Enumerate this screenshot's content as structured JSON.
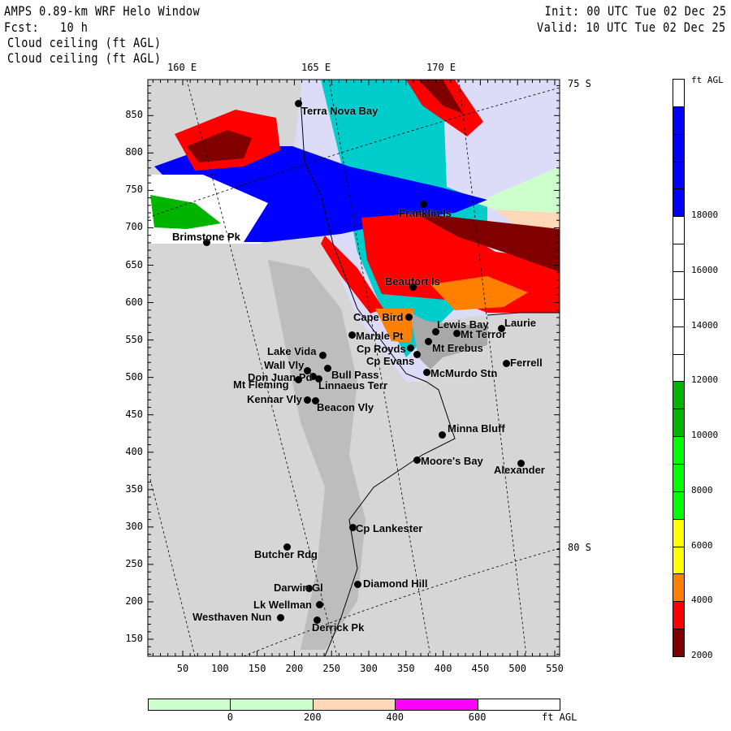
{
  "header": {
    "title": "AMPS 0.89-km WRF Helo Window",
    "forecast": "Fcst:   10 h",
    "field_line1": "Cloud ceiling (ft AGL)",
    "field_line2": "Cloud ceiling (ft AGL)",
    "init": "Init: 00 UTC Tue 02 Dec 25",
    "valid": "Valid: 10 UTC Tue 02 Dec 25"
  },
  "map": {
    "lon_labels": [
      "160 E",
      "165 E",
      "170 E"
    ],
    "lat_labels": [
      "75 S",
      "80 S"
    ],
    "y_ticks": [
      "850",
      "800",
      "750",
      "700",
      "650",
      "600",
      "550",
      "500",
      "450",
      "400",
      "350",
      "300",
      "250",
      "200",
      "150"
    ],
    "x_ticks": [
      "50",
      "100",
      "150",
      "200",
      "250",
      "300",
      "350",
      "400",
      "450",
      "500",
      "550"
    ],
    "stations": [
      "Terra Nova Bay",
      "Franklin Is",
      "Brimstone Pk",
      "Beaufort Is",
      "Cape Bird",
      "Lewis Bay",
      "Laurie",
      "Marble Pt",
      "Mt Terror",
      "Cp Royds",
      "Mt Erebus",
      "Lake Vida",
      "Cp Evans",
      "Ferrell",
      "Wall Vly",
      "Bull Pass",
      "McMurdo Stn",
      "Don Juan Pd",
      "Mt Fleming",
      "Linnaeus Terr",
      "Kennar Vly",
      "Beacon Vly",
      "Minna Bluff",
      "Moore's Bay",
      "Alexander",
      "Cp Lankester",
      "Butcher Rdg",
      "Darwin Gl",
      "Diamond Hill",
      "Lk Wellman",
      "Westhaven Nun",
      "Derrick Pk"
    ]
  },
  "colorbar": {
    "units": "ft AGL",
    "labels": [
      "18000",
      "16000",
      "14000",
      "12000",
      "10000",
      "8000",
      "6000",
      "4000",
      "2000"
    ],
    "colors": [
      "#ffffff",
      "#0000ff",
      "#0000ff",
      "#0000ff",
      "#0000ff",
      "#ffffff",
      "#ffffff",
      "#ffffff",
      "#ffffff",
      "#ffffff",
      "#ffffff",
      "#00b400",
      "#00b400",
      "#00ff00",
      "#00ff00",
      "#00ff00",
      "#ffff00",
      "#ffff00",
      "#ff8000",
      "#ff0000",
      "#800000"
    ]
  },
  "bottom_colorbar": {
    "units": "ft AGL",
    "labels": [
      "0",
      "200",
      "400",
      "600"
    ],
    "colors": [
      "#ccffcc",
      "#ccffcc",
      "#ffd8b8",
      "#ff00ff",
      "#ffffff"
    ]
  }
}
